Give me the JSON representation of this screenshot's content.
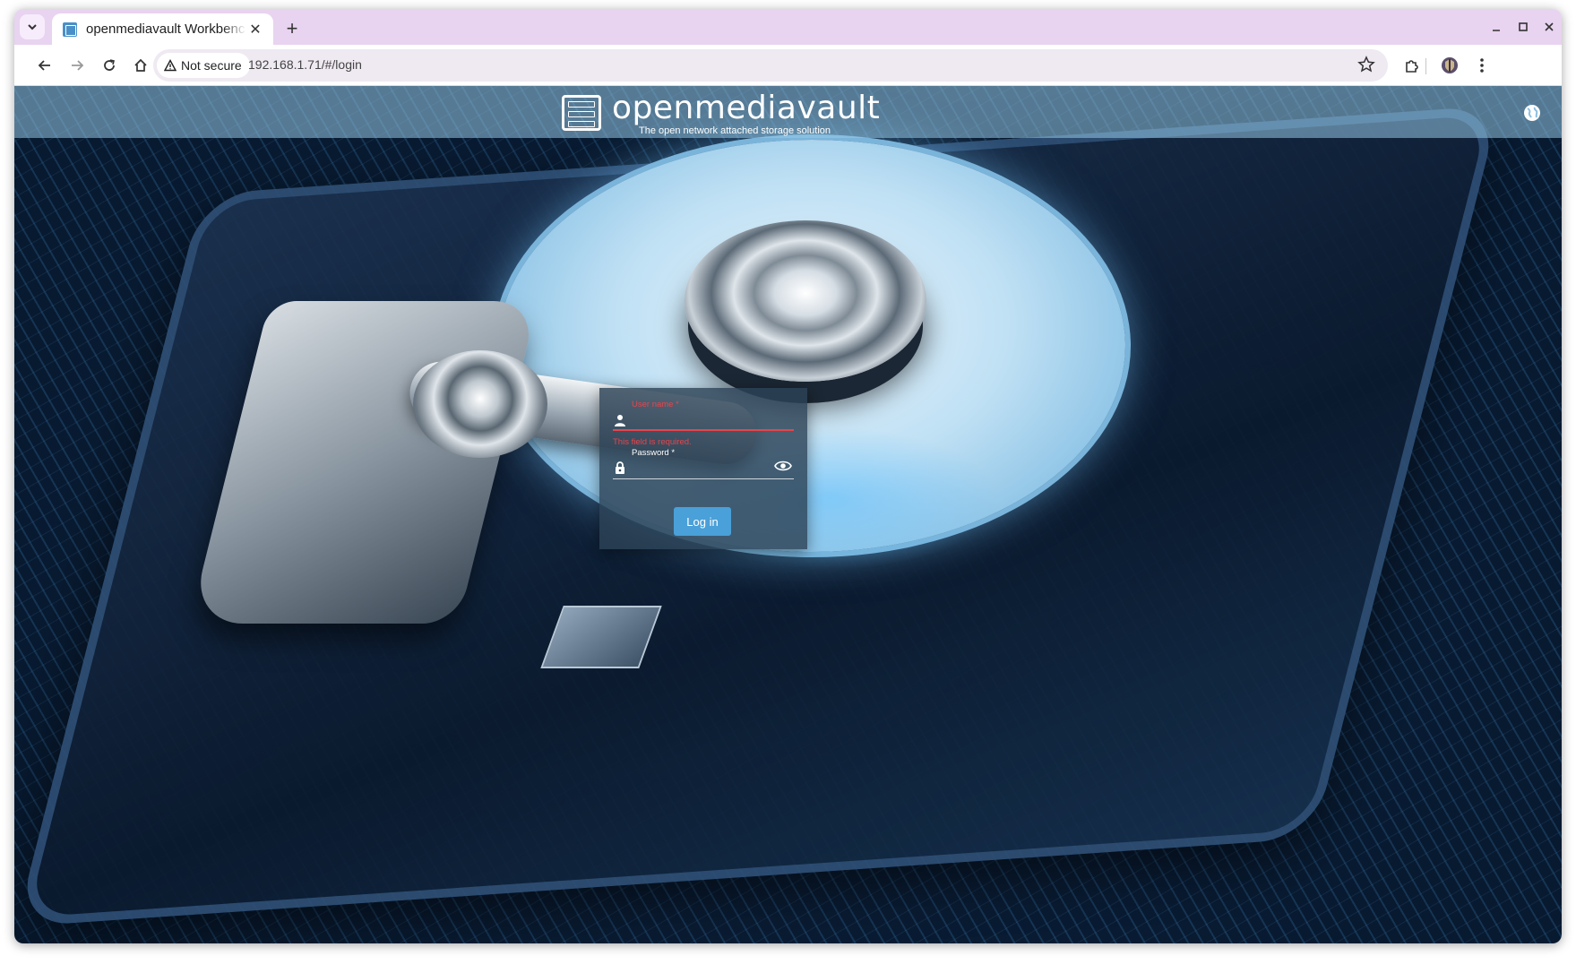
{
  "browser": {
    "tab_title": "openmediavault Workbench",
    "security_label": "Not secure",
    "url": "192.168.1.71/#/login"
  },
  "app": {
    "name": "openmediavault",
    "tagline": "The open network attached storage solution"
  },
  "login": {
    "username_label": "User name *",
    "username_value": "",
    "username_error": "This field is required.",
    "password_label": "Password *",
    "password_value": "",
    "submit_label": "Log in"
  },
  "colors": {
    "accent": "#4aa0d8",
    "error": "#e8444c",
    "tabstrip": "#e8d3f0"
  },
  "icons": {
    "user": "person-icon",
    "password": "lock-icon",
    "reveal": "eye-icon",
    "language": "globe-icon"
  }
}
